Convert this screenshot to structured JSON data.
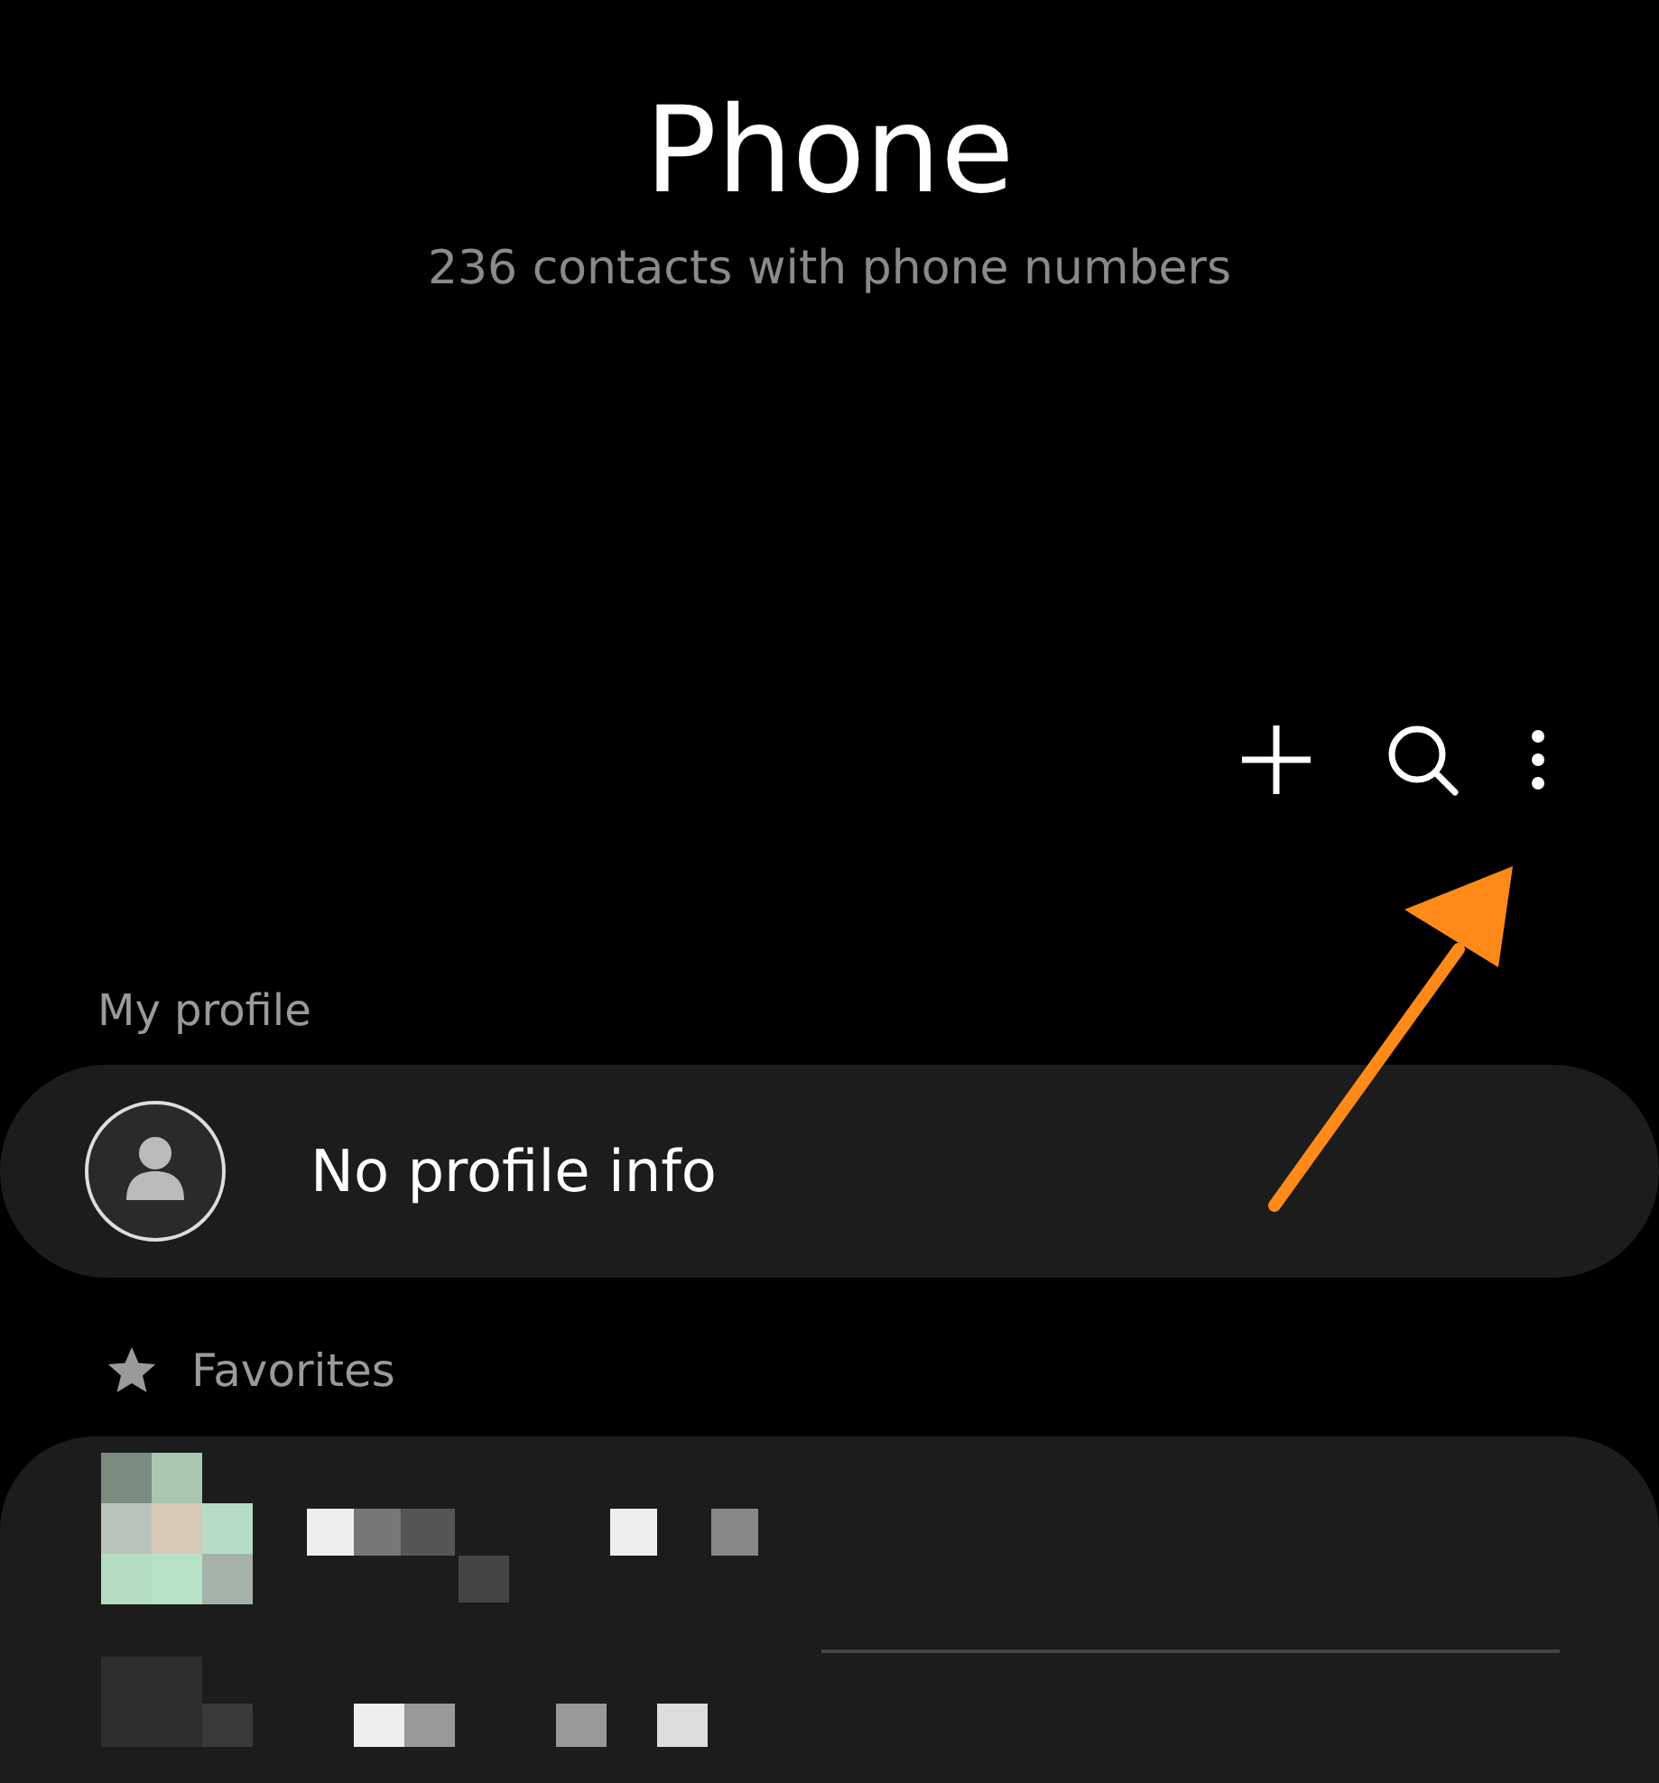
{
  "header": {
    "title": "Phone",
    "subtitle": "236 contacts with phone numbers"
  },
  "toolbar": [
    {
      "kind": "add"
    },
    {
      "kind": "search"
    },
    {
      "kind": "more"
    }
  ],
  "my_profile": {
    "label": "My profile",
    "text": "No profile info"
  },
  "favorites": {
    "label": "Favorites"
  }
}
